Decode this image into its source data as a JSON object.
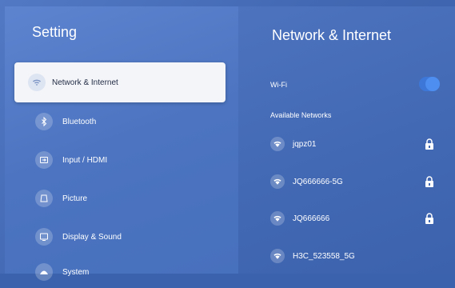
{
  "left_panel": {
    "title": "Setting",
    "items": [
      {
        "label": "Network & Internet",
        "icon": "wifi-icon",
        "selected": true
      },
      {
        "label": "Bluetooth",
        "icon": "bluetooth-icon",
        "selected": false
      },
      {
        "label": "Input / HDMI",
        "icon": "input-icon",
        "selected": false
      },
      {
        "label": "Picture",
        "icon": "picture-icon",
        "selected": false
      },
      {
        "label": "Display & Sound",
        "icon": "display-icon",
        "selected": false
      },
      {
        "label": "System",
        "icon": "system-icon",
        "selected": false
      }
    ]
  },
  "right_panel": {
    "title": "Network & Internet",
    "wifi_label": "Wi-Fi",
    "wifi_enabled": true,
    "available_label": "Available Networks",
    "networks": [
      {
        "ssid": "jqpz01",
        "locked": true
      },
      {
        "ssid": "JQ666666-5G",
        "locked": true
      },
      {
        "ssid": "JQ666666",
        "locked": true
      },
      {
        "ssid": "H3C_523558_5G",
        "locked": false
      }
    ]
  },
  "colors": {
    "accent_toggle": "#3d78d8",
    "selected_bg": "#f4f5f8"
  }
}
